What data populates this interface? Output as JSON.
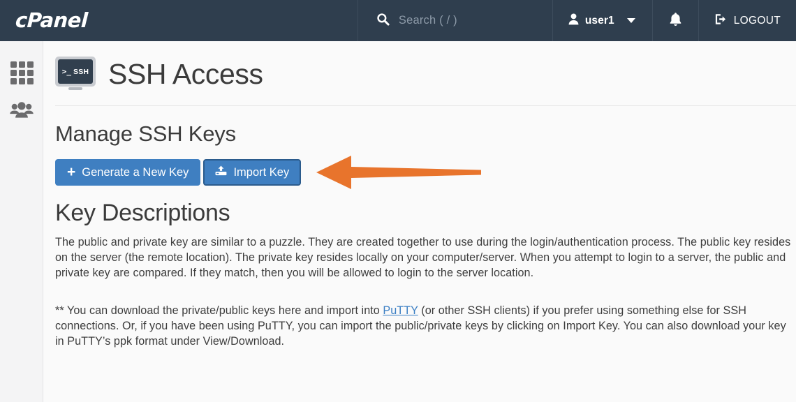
{
  "header": {
    "logo_text": "cPanel",
    "search": {
      "placeholder": "Search ( / )",
      "value": "",
      "icon": "search-icon"
    },
    "user": {
      "name": "user1",
      "icon": "user-icon",
      "caret_icon": "chevron-down-icon"
    },
    "notifications": {
      "icon": "bell-icon"
    },
    "logout": {
      "label": "LOGOUT",
      "icon": "logout-icon"
    },
    "background_color": "#2f3e4e"
  },
  "sidebar": {
    "items": [
      {
        "name": "apps-grid",
        "icon": "grid-icon"
      },
      {
        "name": "user-manager",
        "icon": "users-icon"
      }
    ]
  },
  "main": {
    "page_icon": {
      "prompt": ">_",
      "label": "SSH"
    },
    "page_title": "SSH Access",
    "section_title": "Manage SSH Keys",
    "buttons": {
      "generate": {
        "label": "Generate a New Key",
        "icon": "plus-icon"
      },
      "import": {
        "label": "Import Key",
        "icon": "upload-drive-icon"
      }
    },
    "annotation": {
      "type": "arrow",
      "direction": "left",
      "color": "#e8742c",
      "points_at": "Import Key"
    },
    "descriptions_title": "Key Descriptions",
    "paragraph_1": "The public and private key are similar to a puzzle. They are created together to use during the login/authentication process. The public key resides on the server (the remote location). The private key resides locally on your computer/server. When you attempt to login to a server, the public and private key are compared. If they match, then you will be allowed to login to the server location.",
    "paragraph_2_part_1": "** You can download the private/public keys here and import into ",
    "paragraph_2_link": "PuTTY",
    "paragraph_2_part_2": " (or other SSH clients) if you prefer using something else for SSH connections. Or, if you have been using PuTTY, you can import the public/private keys by clicking on Import Key. You can also download your key in PuTTY’s ppk format under View/Download.",
    "link_color": "#3b7fc4",
    "button_color": "#3f7fc1"
  }
}
